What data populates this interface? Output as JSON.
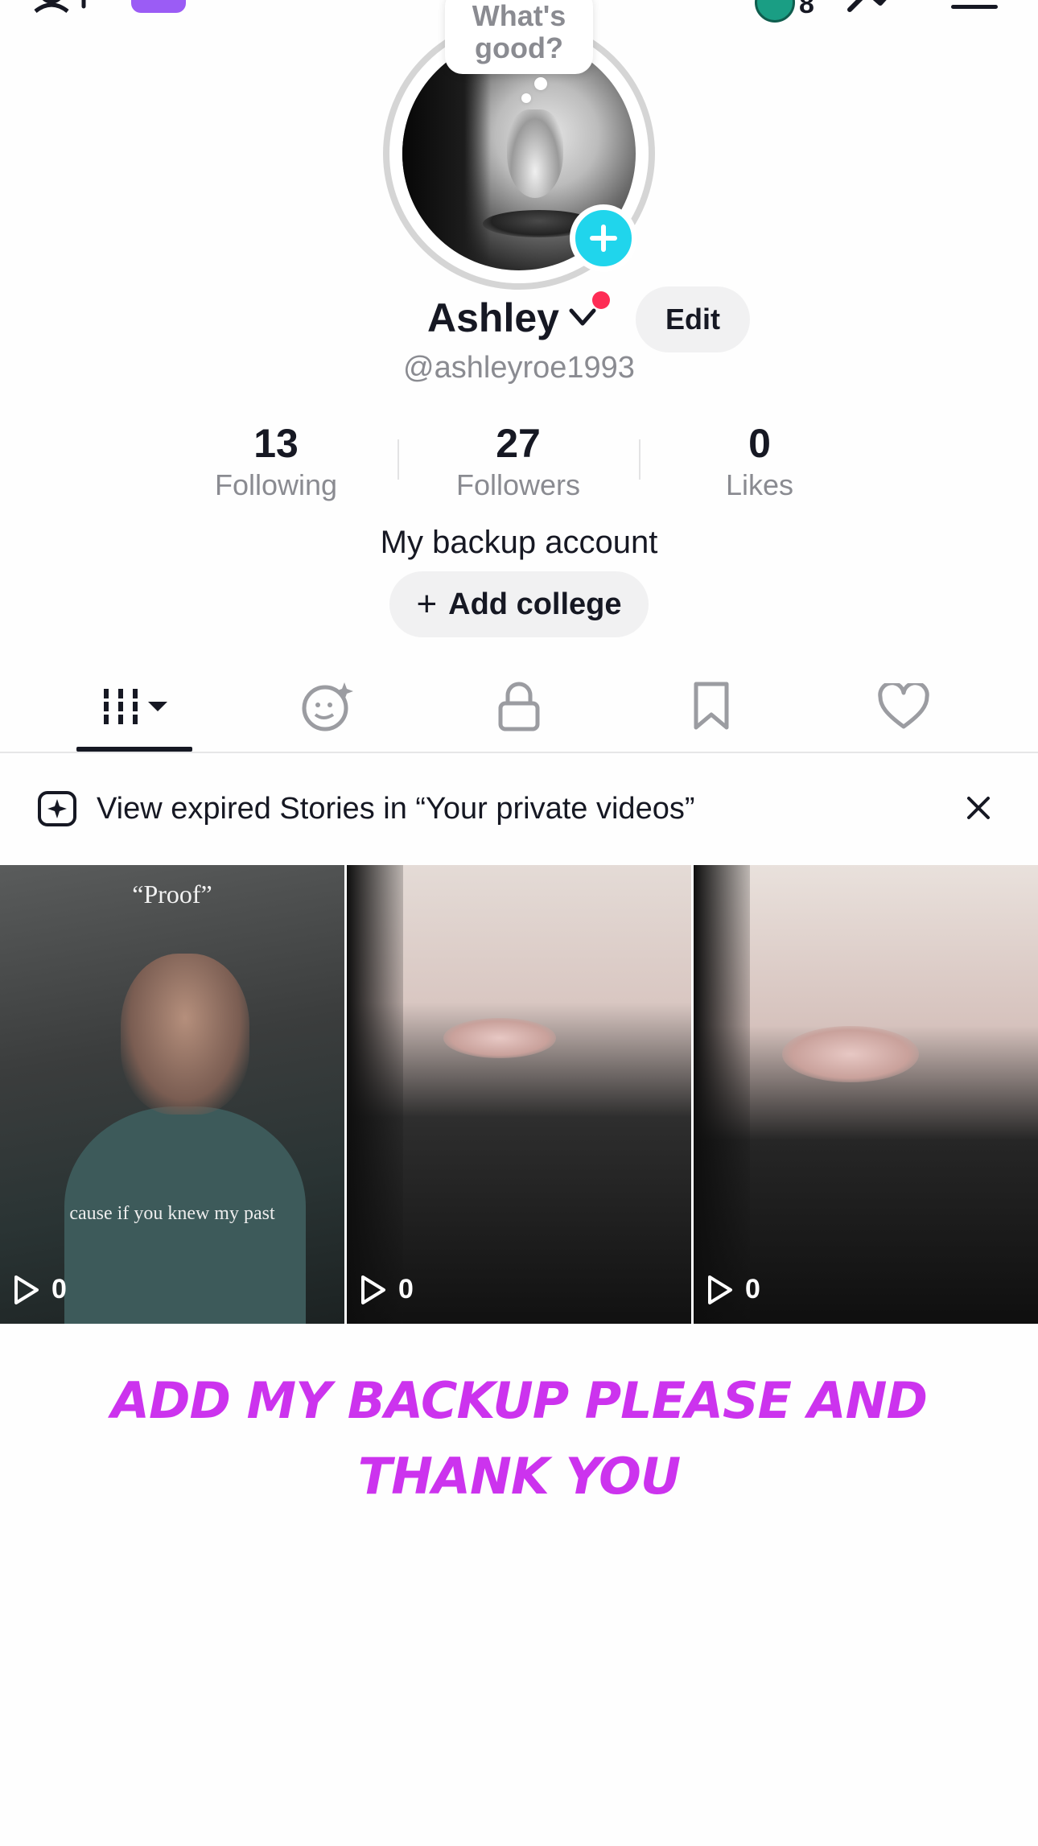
{
  "topbar": {
    "coin_count": "8"
  },
  "avatar": {
    "bubble_text": "What's good?"
  },
  "profile": {
    "name": "Ashley",
    "username": "@ashleyroe1993",
    "edit_label": "Edit",
    "bio": "My backup account",
    "college_label": "Add college"
  },
  "stats": {
    "following": {
      "value": "13",
      "label": "Following"
    },
    "followers": {
      "value": "27",
      "label": "Followers"
    },
    "likes": {
      "value": "0",
      "label": "Likes"
    }
  },
  "tabs": [
    {
      "name": "videos",
      "icon": "grid-icon",
      "active": true
    },
    {
      "name": "reposts",
      "icon": "face-sparkle-icon"
    },
    {
      "name": "private",
      "icon": "lock-icon"
    },
    {
      "name": "favorites",
      "icon": "bookmark-icon"
    },
    {
      "name": "liked",
      "icon": "heart-icon"
    }
  ],
  "notice": {
    "text": "View expired Stories in “Your private videos”"
  },
  "videos": [
    {
      "caption_top": "“Proof”",
      "caption_bottom": "cause if you knew my past",
      "views": "0"
    },
    {
      "views": "0"
    },
    {
      "views": "0"
    }
  ],
  "banner": {
    "line1": "ADD MY BACKUP PLEASE AND",
    "line2": "THANK YOU"
  },
  "colors": {
    "accent_cyan": "#20d5ec",
    "notification_red": "#fe2c55",
    "banner_purple": "#cc33ee",
    "muted_text": "#8a8b91"
  }
}
